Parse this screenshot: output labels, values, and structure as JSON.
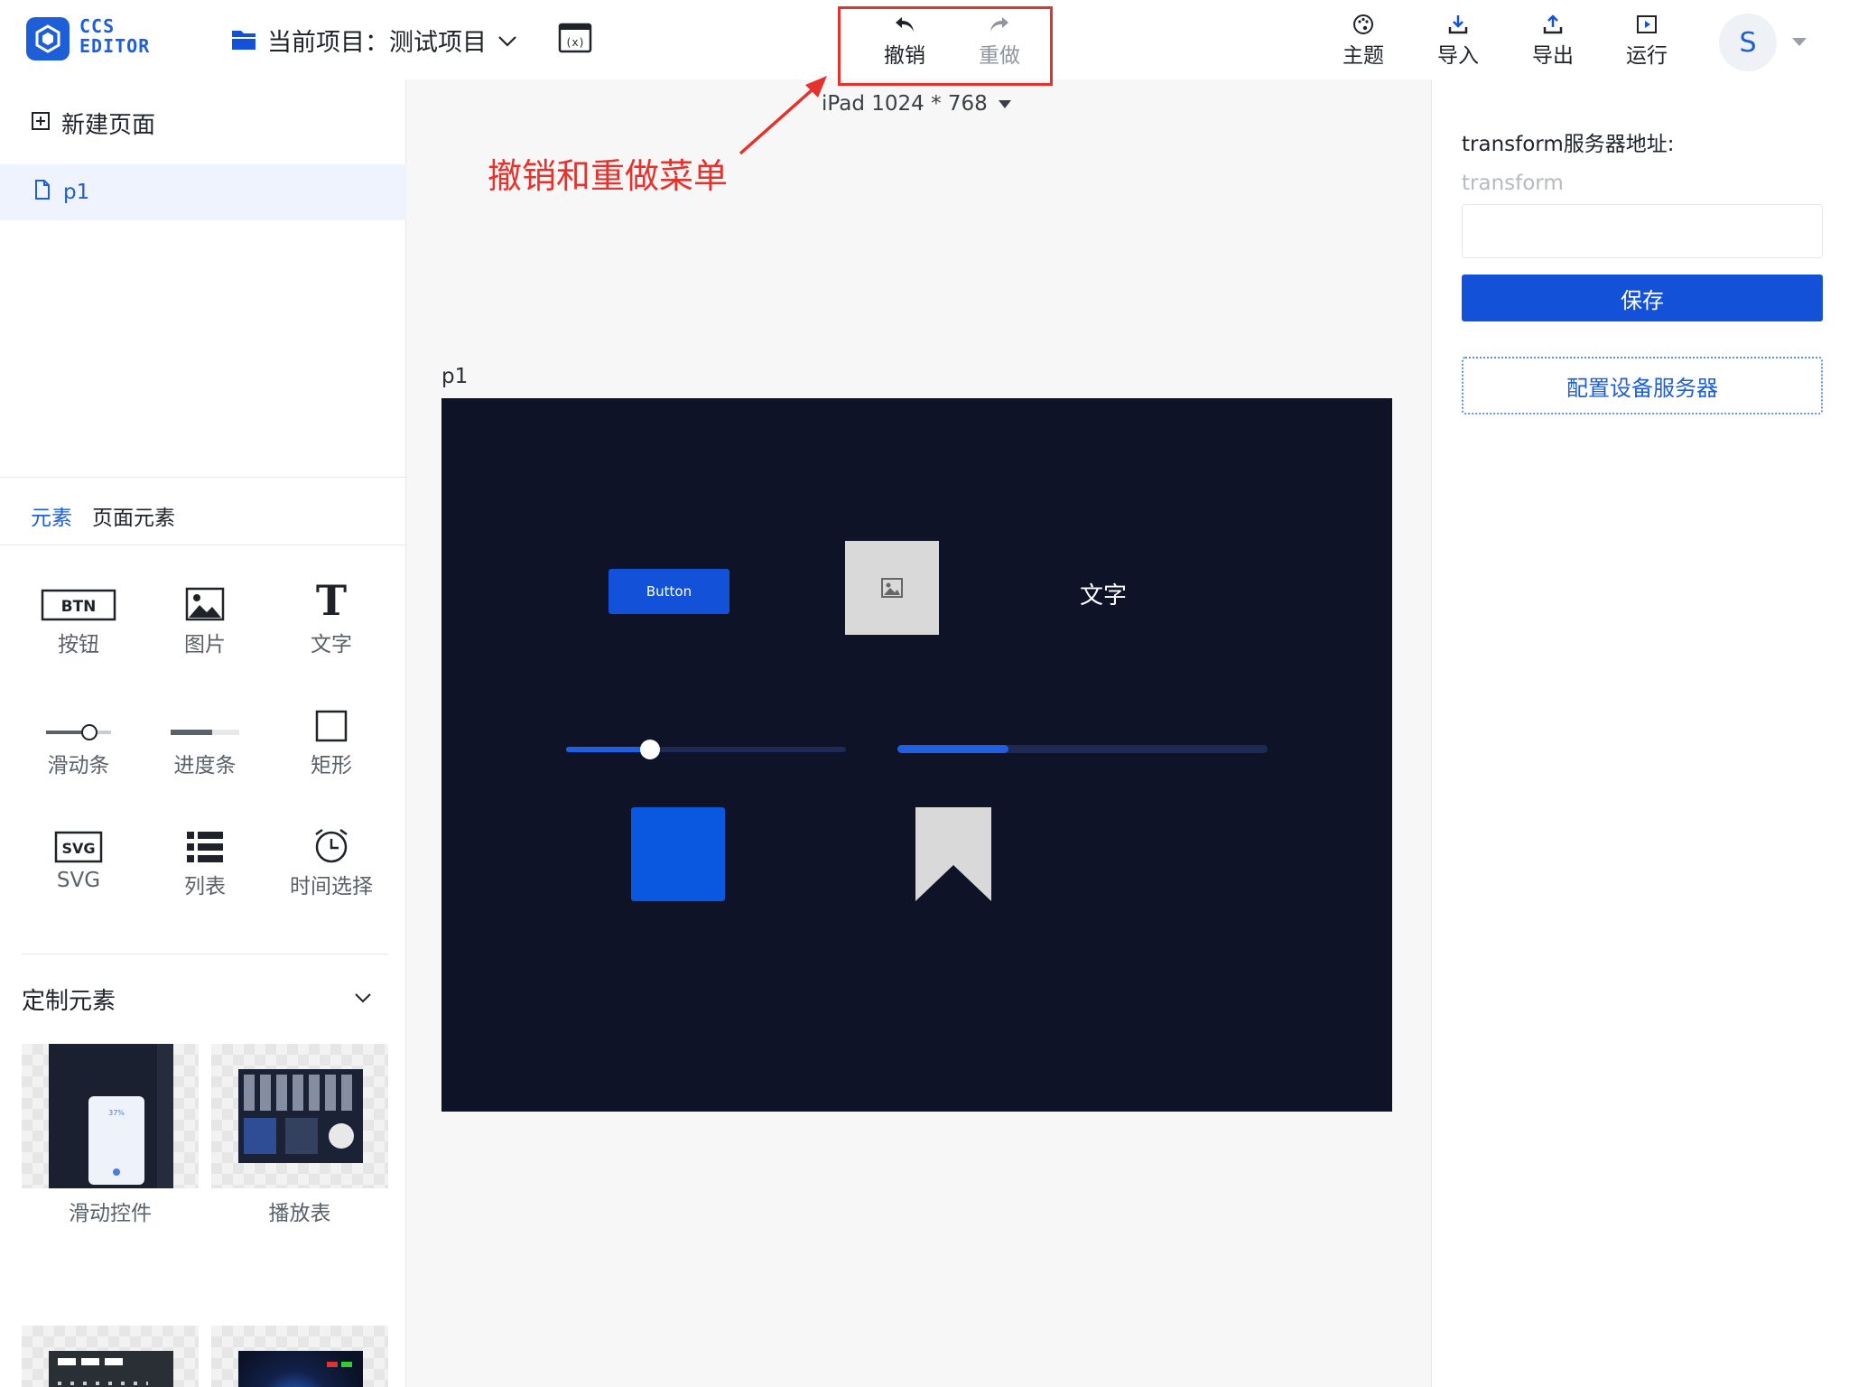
{
  "header": {
    "logo_line1": "CCS",
    "logo_line2": "EDITOR",
    "project_label": "当前项目：",
    "project_name": "测试项目",
    "undo_label": "撤销",
    "redo_label": "重做",
    "theme_label": "主题",
    "import_label": "导入",
    "export_label": "导出",
    "run_label": "运行",
    "avatar_initial": "S",
    "icons": [
      "folder-icon",
      "variable-icon",
      "undo-icon",
      "redo-icon",
      "palette-icon",
      "download-icon",
      "upload-icon",
      "play-icon",
      "chevron-down-icon"
    ]
  },
  "sidebar": {
    "new_page_label": "新建页面",
    "pages": [
      {
        "name": "p1"
      }
    ],
    "tabs": [
      {
        "label": "元素",
        "active": true
      },
      {
        "label": "页面元素",
        "active": false
      }
    ],
    "elements": [
      {
        "label": "按钮",
        "icon": "btn-icon",
        "icon_text": "BTN"
      },
      {
        "label": "图片",
        "icon": "image-icon"
      },
      {
        "label": "文字",
        "icon": "text-icon",
        "icon_text": "T"
      },
      {
        "label": "滑动条",
        "icon": "slider-icon"
      },
      {
        "label": "进度条",
        "icon": "progress-icon"
      },
      {
        "label": "矩形",
        "icon": "rect-icon"
      },
      {
        "label": "SVG",
        "icon": "svg-icon",
        "icon_text": "SVG"
      },
      {
        "label": "列表",
        "icon": "list-icon"
      },
      {
        "label": "时间选择",
        "icon": "clock-icon"
      }
    ],
    "custom_title": "定制元素",
    "custom_items": [
      {
        "label": "滑动控件",
        "thumb_text": "37%"
      },
      {
        "label": "播放表"
      },
      {
        "label": ""
      },
      {
        "label": ""
      }
    ]
  },
  "canvas": {
    "device_label": "iPad 1024 * 768",
    "annotation": "撤销和重做菜单",
    "page_label": "p1",
    "button_text": "Button",
    "text_element": "文字",
    "slider_value": 0.3,
    "progress_value": 0.3,
    "colors": {
      "stage_bg": "#0e1328",
      "accent": "#1352d8",
      "annotation": "#e5322d"
    }
  },
  "panel": {
    "server_label": "transform服务器地址:",
    "input_label": "transform",
    "input_value": "",
    "save_label": "保存",
    "config_label": "配置设备服务器"
  }
}
